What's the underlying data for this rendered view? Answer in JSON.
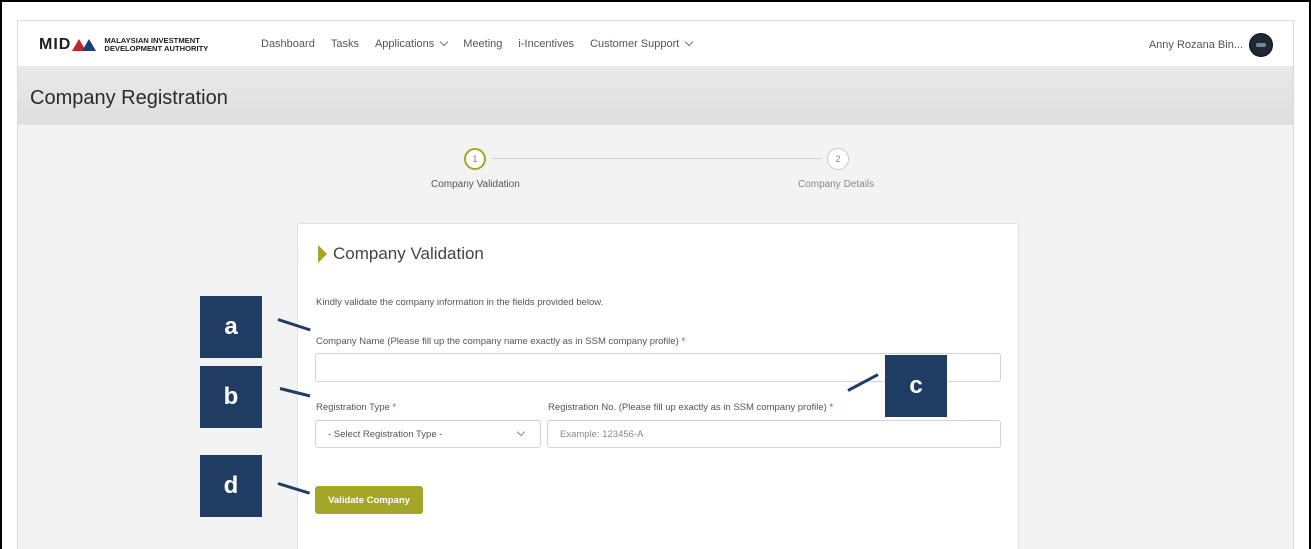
{
  "brand": {
    "logo_mark": "MIDA",
    "logo_line1": "MALAYSIAN INVESTMENT",
    "logo_line2": "DEVELOPMENT AUTHORITY"
  },
  "nav": {
    "items": [
      {
        "label": "Dashboard",
        "dropdown": false
      },
      {
        "label": "Tasks",
        "dropdown": false
      },
      {
        "label": "Applications",
        "dropdown": true
      },
      {
        "label": "Meeting",
        "dropdown": false
      },
      {
        "label": "i-Incentives",
        "dropdown": false
      },
      {
        "label": "Customer Support",
        "dropdown": true
      }
    ],
    "user_name": "Anny Rozana Bin..."
  },
  "page": {
    "title": "Company Registration"
  },
  "stepper": {
    "steps": [
      {
        "number": "1",
        "label": "Company Validation",
        "active": true
      },
      {
        "number": "2",
        "label": "Company Details",
        "active": false
      }
    ]
  },
  "form": {
    "title": "Company Validation",
    "intro": "Kindly validate the company information in the fields provided below.",
    "company_name_label": "Company Name (Please fill up the company name exactly as in SSM company profile)",
    "company_name_value": "",
    "registration_type_label": "Registration Type",
    "registration_type_value": "- Select Registration Type -",
    "registration_no_label": "Registration No. (Please fill up exactly as in SSM company profile)",
    "registration_no_placeholder": "Example: 123456-A",
    "required_mark": "*",
    "validate_button": "Validate Company"
  },
  "callouts": [
    "a",
    "b",
    "c",
    "d"
  ],
  "colors": {
    "accent": "#a3a627",
    "callout_bg": "#1f3d62",
    "required": "#d0342c"
  }
}
